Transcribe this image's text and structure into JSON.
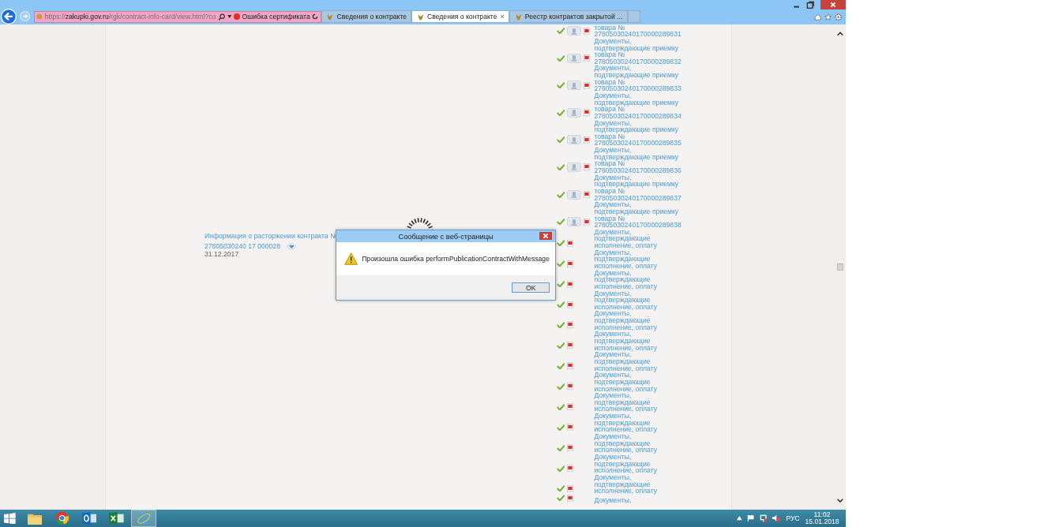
{
  "browser": {
    "address": "https://**zakupki.gov.ru**/rgk/contract-info-card/view.html?co",
    "certificate_error": "Ошибка сертификата",
    "tabs": [
      {
        "label": "Сведения о контракте",
        "selected": false
      },
      {
        "label": "Сведения о контракте",
        "selected": true
      },
      {
        "label": "Реестр контрактов закрытой ...",
        "selected": false
      }
    ],
    "tab_close": "×"
  },
  "termination": {
    "title": "Информация о расторжении контракта №",
    "number": "27805030240 17 000028",
    "date": "31.12.2017"
  },
  "documents": [
    {
      "kind": "acceptance",
      "text": "товара №",
      "number": "27805030240170000289831"
    },
    {
      "kind": "acceptance",
      "text": "Документы, подтверждающие приемку товара №",
      "number": "27805030240170000289832"
    },
    {
      "kind": "acceptance",
      "text": "Документы, подтверждающие приемку товара №",
      "number": "27805030240170000289833"
    },
    {
      "kind": "acceptance",
      "text": "Документы, подтверждающие приемку товара №",
      "number": "27805030240170000289834"
    },
    {
      "kind": "acceptance",
      "text": "Документы, подтверждающие приемку товара №",
      "number": "27805030240170000289835"
    },
    {
      "kind": "acceptance",
      "text": "Документы, подтверждающие приемку товара №",
      "number": "27805030240170000289836"
    },
    {
      "kind": "acceptance",
      "text": "Документы, подтверждающие приемку товара №",
      "number": "27805030240170000289837"
    },
    {
      "kind": "acceptance",
      "text": "Документы, подтверждающие приемку товара №",
      "number": "27805030240170000289838"
    },
    {
      "kind": "payment",
      "text": "Документы, подтверждающие исполнение, оплату"
    },
    {
      "kind": "payment",
      "text": "Документы, подтверждающие исполнение, оплату"
    },
    {
      "kind": "payment",
      "text": "Документы, подтверждающие исполнение, оплату"
    },
    {
      "kind": "payment",
      "text": "Документы, подтверждающие исполнение, оплату"
    },
    {
      "kind": "payment",
      "text": "Документы, подтверждающие исполнение, оплату"
    },
    {
      "kind": "payment",
      "text": "Документы, подтверждающие исполнение, оплату"
    },
    {
      "kind": "payment",
      "text": "Документы, подтверждающие исполнение, оплату"
    },
    {
      "kind": "payment",
      "text": "Документы, подтверждающие исполнение, оплату"
    },
    {
      "kind": "payment",
      "text": "Документы, подтверждающие исполнение, оплату"
    },
    {
      "kind": "payment",
      "text": "Документы, подтверждающие исполнение, оплату"
    },
    {
      "kind": "payment",
      "text": "Документы, подтверждающие исполнение, оплату"
    },
    {
      "kind": "payment",
      "text": "Документы, подтверждающие исполнение, оплату"
    },
    {
      "kind": "payment",
      "text": "Документы, подтверждающие исполнение, оплату"
    },
    {
      "kind": "payment",
      "text": "Документы,"
    }
  ],
  "dialog": {
    "title": "Сообщение с веб-страницы",
    "message": "Произошла ошибка performPublicationContractWithMessage",
    "button": "OK"
  },
  "taskbar": {
    "apps": [
      {
        "kind": "folder",
        "selected": false
      },
      {
        "kind": "chrome",
        "selected": false
      },
      {
        "kind": "outlook",
        "selected": false
      },
      {
        "kind": "excel",
        "selected": false
      },
      {
        "kind": "ie",
        "selected": true
      }
    ],
    "language": "РУС",
    "time": "11:02",
    "date": "15.01.2018"
  }
}
